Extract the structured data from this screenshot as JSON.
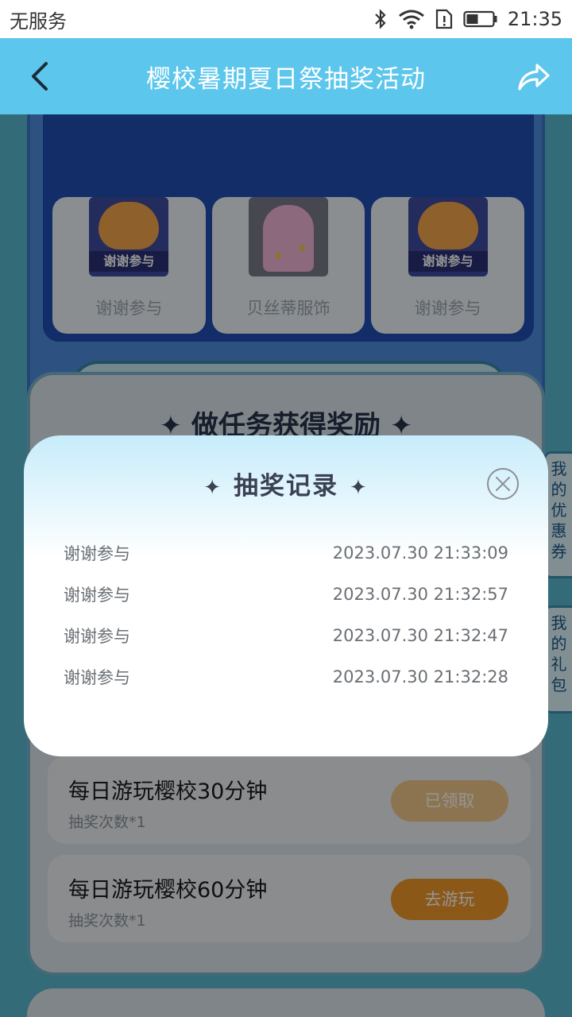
{
  "status_bar": {
    "carrier": "无服务",
    "time": "21:35",
    "icons": [
      "bluetooth-icon",
      "wifi-icon",
      "sim-alert-icon",
      "battery-icon"
    ]
  },
  "navbar": {
    "title": "樱校暑期夏日祭抽奖活动",
    "back_icon": "chevron-left-icon",
    "share_icon": "share-arrow-icon"
  },
  "prizes": [
    {
      "label": "谢谢参与",
      "badge": "谢谢参与",
      "kind": "cat"
    },
    {
      "label": "贝丝蒂服饰",
      "kind": "dress"
    },
    {
      "label": "谢谢参与",
      "badge": "谢谢参与",
      "kind": "cat"
    }
  ],
  "record_button": "抽奖记录",
  "tasks": {
    "title": "✦ 做任务获得奖励 ✦",
    "items": [
      {
        "name": "每日游玩樱校30分钟",
        "sub": "抽奖次数*1",
        "button": "已领取",
        "state": "done"
      },
      {
        "name": "每日游玩樱校60分钟",
        "sub": "抽奖次数*1",
        "button": "去游玩",
        "state": "go"
      }
    ]
  },
  "side_tabs": {
    "coupons": "我的优惠券",
    "gifts": "我的礼包"
  },
  "modal": {
    "title": "抽奖记录",
    "close_icon": "close-circle-icon",
    "records": [
      {
        "prize": "谢谢参与",
        "time": "2023.07.30 21:33:09"
      },
      {
        "prize": "谢谢参与",
        "time": "2023.07.30 21:32:57"
      },
      {
        "prize": "谢谢参与",
        "time": "2023.07.30 21:32:47"
      },
      {
        "prize": "谢谢参与",
        "time": "2023.07.30 21:32:28"
      }
    ]
  },
  "colors": {
    "navbar": "#5cc6ec",
    "modal_top": "#c7ecfb",
    "go_button": "#f0982a",
    "done_button": "#f3c98c"
  }
}
